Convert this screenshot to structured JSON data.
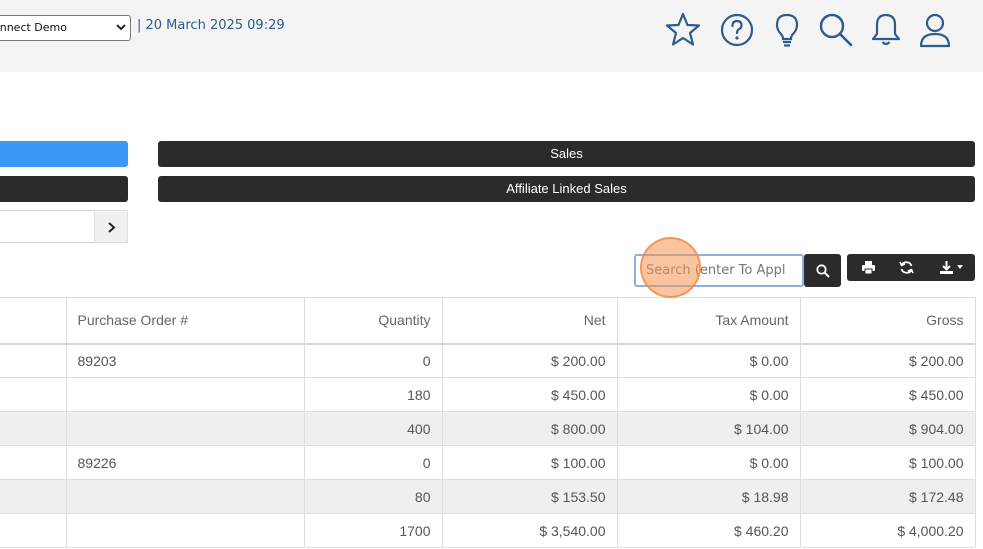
{
  "header": {
    "company_select_value": "onnect Demo",
    "datetime": "| 20 March 2025 09:29",
    "icons": [
      "star-icon",
      "help-icon",
      "lightbulb-icon",
      "search-icon",
      "bell-icon",
      "user-icon"
    ],
    "accent_color": "#2f5a8c"
  },
  "buttons": {
    "sales": "Sales",
    "affiliate_linked_sales": "Affiliate Linked Sales",
    "blue_color": "#3b98f5",
    "dark_color": "#2b2b2b"
  },
  "search": {
    "placeholder": "Search (enter To Appl"
  },
  "table": {
    "columns": [
      "",
      "Purchase Order #",
      "Quantity",
      "Net",
      "Tax Amount",
      "Gross"
    ],
    "rows": [
      {
        "po": "89203",
        "qty": "0",
        "net": "$ 200.00",
        "tax": "$ 0.00",
        "gross": "$ 200.00"
      },
      {
        "po": "",
        "qty": "180",
        "net": "$ 450.00",
        "tax": "$ 0.00",
        "gross": "$ 450.00"
      },
      {
        "po": "",
        "qty": "400",
        "net": "$ 800.00",
        "tax": "$ 104.00",
        "gross": "$ 904.00"
      },
      {
        "po": "89226",
        "qty": "0",
        "net": "$ 100.00",
        "tax": "$ 0.00",
        "gross": "$ 100.00"
      },
      {
        "po": "",
        "qty": "80",
        "net": "$ 153.50",
        "tax": "$ 18.98",
        "gross": "$ 172.48"
      },
      {
        "po": "",
        "qty": "1700",
        "net": "$ 3,540.00",
        "tax": "$ 460.20",
        "gross": "$ 4,000.20"
      }
    ]
  }
}
